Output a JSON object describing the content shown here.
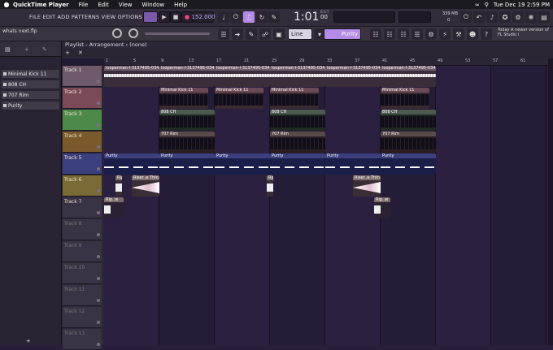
{
  "mac_menu": {
    "apple": "",
    "app": "QuickTime Player",
    "items": [
      "File",
      "Edit",
      "View",
      "Window",
      "Help"
    ],
    "clock": "Tue Dec 19  2:59 PM"
  },
  "fl_menu": "FILE EDIT ADD PATTERNS VIEW OPTIONS TOOLS HELP",
  "transport": {
    "tempo": "152.000",
    "time": "1:01",
    "time_sub": "00",
    "bst": "B:S:T",
    "ram": "339 MB",
    "cpu": "0"
  },
  "toolbar2": {
    "project": "whats next.flp",
    "snap": "Line",
    "pattern": "Purity",
    "hint": "Today  A newer version of FL Studio i"
  },
  "playlist_title": "Playlist - Arrangement › (none)",
  "browser_items": [
    "Minimal Kick 11",
    "808 CH",
    "707 Rim",
    "Purity"
  ],
  "tracks": [
    "Track 1",
    "Track 2",
    "Track 3",
    "Track 4",
    "Track 5",
    "Track 6",
    "Track 7",
    "Track 8",
    "Track 9",
    "Track 10",
    "Track 11",
    "Track 12",
    "Track 13"
  ],
  "ruler": [
    "1",
    "5",
    "9",
    "13",
    "17",
    "21",
    "25",
    "29",
    "33",
    "37",
    "41",
    "45",
    "49",
    "53",
    "57",
    "61"
  ],
  "clip_labels": {
    "audio": "looperman-l-3137495-034178...",
    "kick": "Minimal Kick 11",
    "ch": "808 CH",
    "rim": "707 Rim",
    "purity": "Purity",
    "riser": "Riser..e Thin",
    "small": "Rip..w"
  },
  "colors": {
    "bg": "#221a30",
    "accent": "#b58be8",
    "track1": "#6e5a6a",
    "track2": "#7a4a57",
    "track3": "#4d8a4a",
    "track4": "#7a5a2a",
    "track5": "#3c3f7d",
    "track6": "#7a6a35"
  }
}
